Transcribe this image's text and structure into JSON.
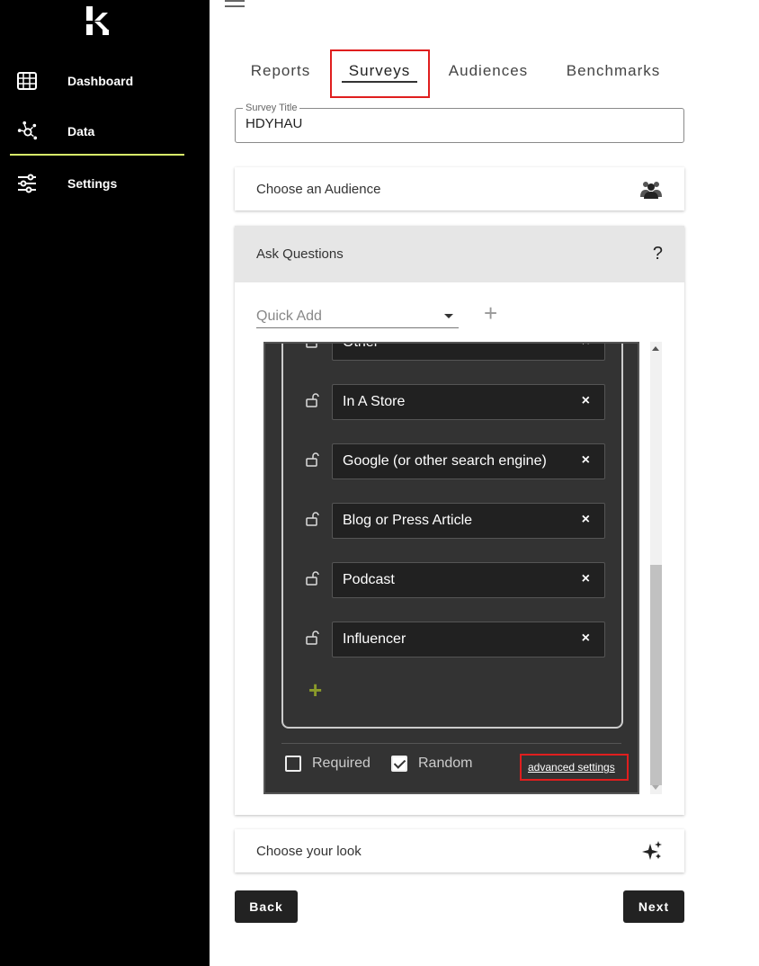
{
  "sidebar": {
    "logo_icon": "k-logo-icon",
    "items": [
      {
        "label": "Dashboard",
        "icon": "grid-icon",
        "active": false
      },
      {
        "label": "Data",
        "icon": "network-icon",
        "active": true
      },
      {
        "label": "Settings",
        "icon": "sliders-icon",
        "active": false
      }
    ],
    "active_line_color": "#d8ef6a"
  },
  "header": {
    "menu_icon": "hamburger-icon"
  },
  "tabs": [
    {
      "label": "Reports",
      "active": false
    },
    {
      "label": "Surveys",
      "active": true
    },
    {
      "label": "Audiences",
      "active": false
    },
    {
      "label": "Benchmarks",
      "active": false
    }
  ],
  "survey_title": {
    "legend": "Survey Title",
    "value": "HDYHAU"
  },
  "audience_card": {
    "label": "Choose an Audience",
    "icon": "people-icon"
  },
  "questions_card": {
    "label": "Ask Questions",
    "icon": "question-icon",
    "quick_add": {
      "placeholder": "Quick Add"
    },
    "answers": [
      {
        "text": "Other"
      },
      {
        "text": "In A Store"
      },
      {
        "text": "Google (or other search engine)"
      },
      {
        "text": "Blog or Press Article"
      },
      {
        "text": "Podcast"
      },
      {
        "text": "Influencer"
      }
    ],
    "remove_glyph": "×",
    "required": {
      "label": "Required",
      "checked": false
    },
    "random": {
      "label": "Random",
      "checked": true
    },
    "advanced_settings_label": "advanced settings"
  },
  "look_card": {
    "label": "Choose your look",
    "icon": "sparkle-icon"
  },
  "footer": {
    "back_label": "Back",
    "next_label": "Next"
  },
  "colors": {
    "sidebar_bg": "#000000",
    "panel_bg": "#333333",
    "highlight": "#e01e1e",
    "accent_plus": "#8a9a2a"
  }
}
